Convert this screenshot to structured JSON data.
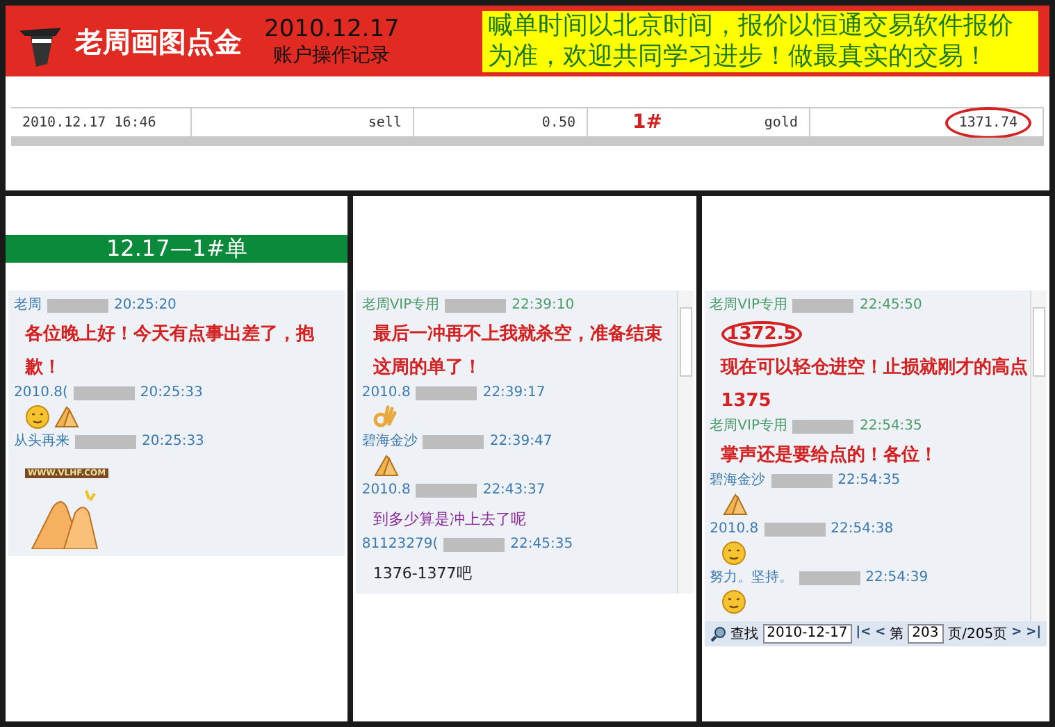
{
  "header": {
    "logo_text": "老周画图点金",
    "date": "2010.12.17",
    "subtitle": "账户操作记录",
    "notice": "喊单时间以北京时间，报价以恒通交易软件报价为准，欢迎共同学习进步！做最真实的交易！"
  },
  "trade_row": {
    "cells": [
      {
        "text": "2010.12.17 16:46",
        "circled": false
      },
      {
        "text": "sell",
        "circled": false
      },
      {
        "text": "0.50",
        "circled": false
      },
      {
        "text": "gold",
        "circled": false
      },
      {
        "text": "1371.74",
        "circled": true
      }
    ],
    "order_mark": "1#"
  },
  "panels": [
    {
      "banner": "12.17—1#单",
      "scrollbar": false,
      "messages": [
        {
          "kind": "meta",
          "name": "老周",
          "time": "20:25:20",
          "color": "#3a78b0"
        },
        {
          "kind": "text",
          "text": "各位晚上好！今天有点事出差了，抱歉！",
          "color": "#d42222"
        },
        {
          "kind": "meta",
          "name": "2010.8(",
          "time": "20:25:33",
          "color": "#3a78b0"
        },
        {
          "kind": "emoji",
          "icons": [
            {
              "kind": "face"
            },
            {
              "kind": "palms"
            }
          ]
        },
        {
          "kind": "meta",
          "name": "从头再来",
          "time": "20:25:33",
          "color": "#3a78b0"
        },
        {
          "kind": "tag",
          "text": "WWW.VLHF.COM"
        },
        {
          "kind": "emoji",
          "icons": [
            {
              "kind": "clap"
            }
          ]
        }
      ]
    },
    {
      "scrollbar": true,
      "messages": [
        {
          "kind": "meta",
          "name": "老周VIP专用",
          "time": "22:39:10",
          "color": "#4a9a6a"
        },
        {
          "kind": "text",
          "text": "最后一冲再不上我就杀空，准备结束这周的单了！",
          "color": "#d42222"
        },
        {
          "kind": "meta",
          "name": "2010.8",
          "time": "22:39:17",
          "color": "#3a78b0"
        },
        {
          "kind": "emoji",
          "icons": [
            {
              "kind": "ok"
            }
          ]
        },
        {
          "kind": "meta",
          "name": "碧海金沙",
          "time": "22:39:47",
          "color": "#3a78b0"
        },
        {
          "kind": "emoji",
          "icons": [
            {
              "kind": "palms"
            }
          ]
        },
        {
          "kind": "meta",
          "name": "2010.8",
          "time": "22:43:37",
          "color": "#3a78b0"
        },
        {
          "kind": "text",
          "text": "到多少算是冲上去了呢",
          "color": "#8a2a9a",
          "plain": true
        },
        {
          "kind": "meta",
          "name": "81123279(",
          "time": "22:45:35",
          "color": "#3a78b0"
        },
        {
          "kind": "text",
          "text": "1376-1377吧",
          "color": "#222222",
          "plain": true
        }
      ]
    },
    {
      "scrollbar": true,
      "messages": [
        {
          "kind": "meta",
          "name": "老周VIP专用",
          "time": "22:45:50",
          "color": "#4a9a6a"
        },
        {
          "kind": "text",
          "circled": "1372.5",
          "text": "现在可以轻仓进空！止损就刚才的高点1375",
          "color": "#d42222"
        },
        {
          "kind": "meta",
          "name": "老周VIP专用",
          "time": "22:54:35",
          "color": "#4a9a6a"
        },
        {
          "kind": "text",
          "text": "掌声还是要给点的！各位！",
          "color": "#d42222"
        },
        {
          "kind": "meta",
          "name": "碧海金沙",
          "time": "22:54:35",
          "color": "#3a78b0"
        },
        {
          "kind": "emoji",
          "icons": [
            {
              "kind": "palms"
            }
          ]
        },
        {
          "kind": "meta",
          "name": "2010.8",
          "time": "22:54:38",
          "color": "#3a78b0"
        },
        {
          "kind": "emoji",
          "icons": [
            {
              "kind": "face"
            }
          ]
        },
        {
          "kind": "meta",
          "name": "努力。坚持。",
          "time": "22:54:39",
          "color": "#3a78b0"
        },
        {
          "kind": "emoji",
          "icons": [
            {
              "kind": "face"
            }
          ]
        }
      ],
      "toolbar": {
        "search_label": "查找",
        "date": "2010-12-17",
        "prev_buttons": [
          "|<",
          "<"
        ],
        "page_prefix": "第",
        "page": "203",
        "page_suffix": "页/205页",
        "next_buttons": [
          ">",
          ">|"
        ]
      }
    }
  ]
}
